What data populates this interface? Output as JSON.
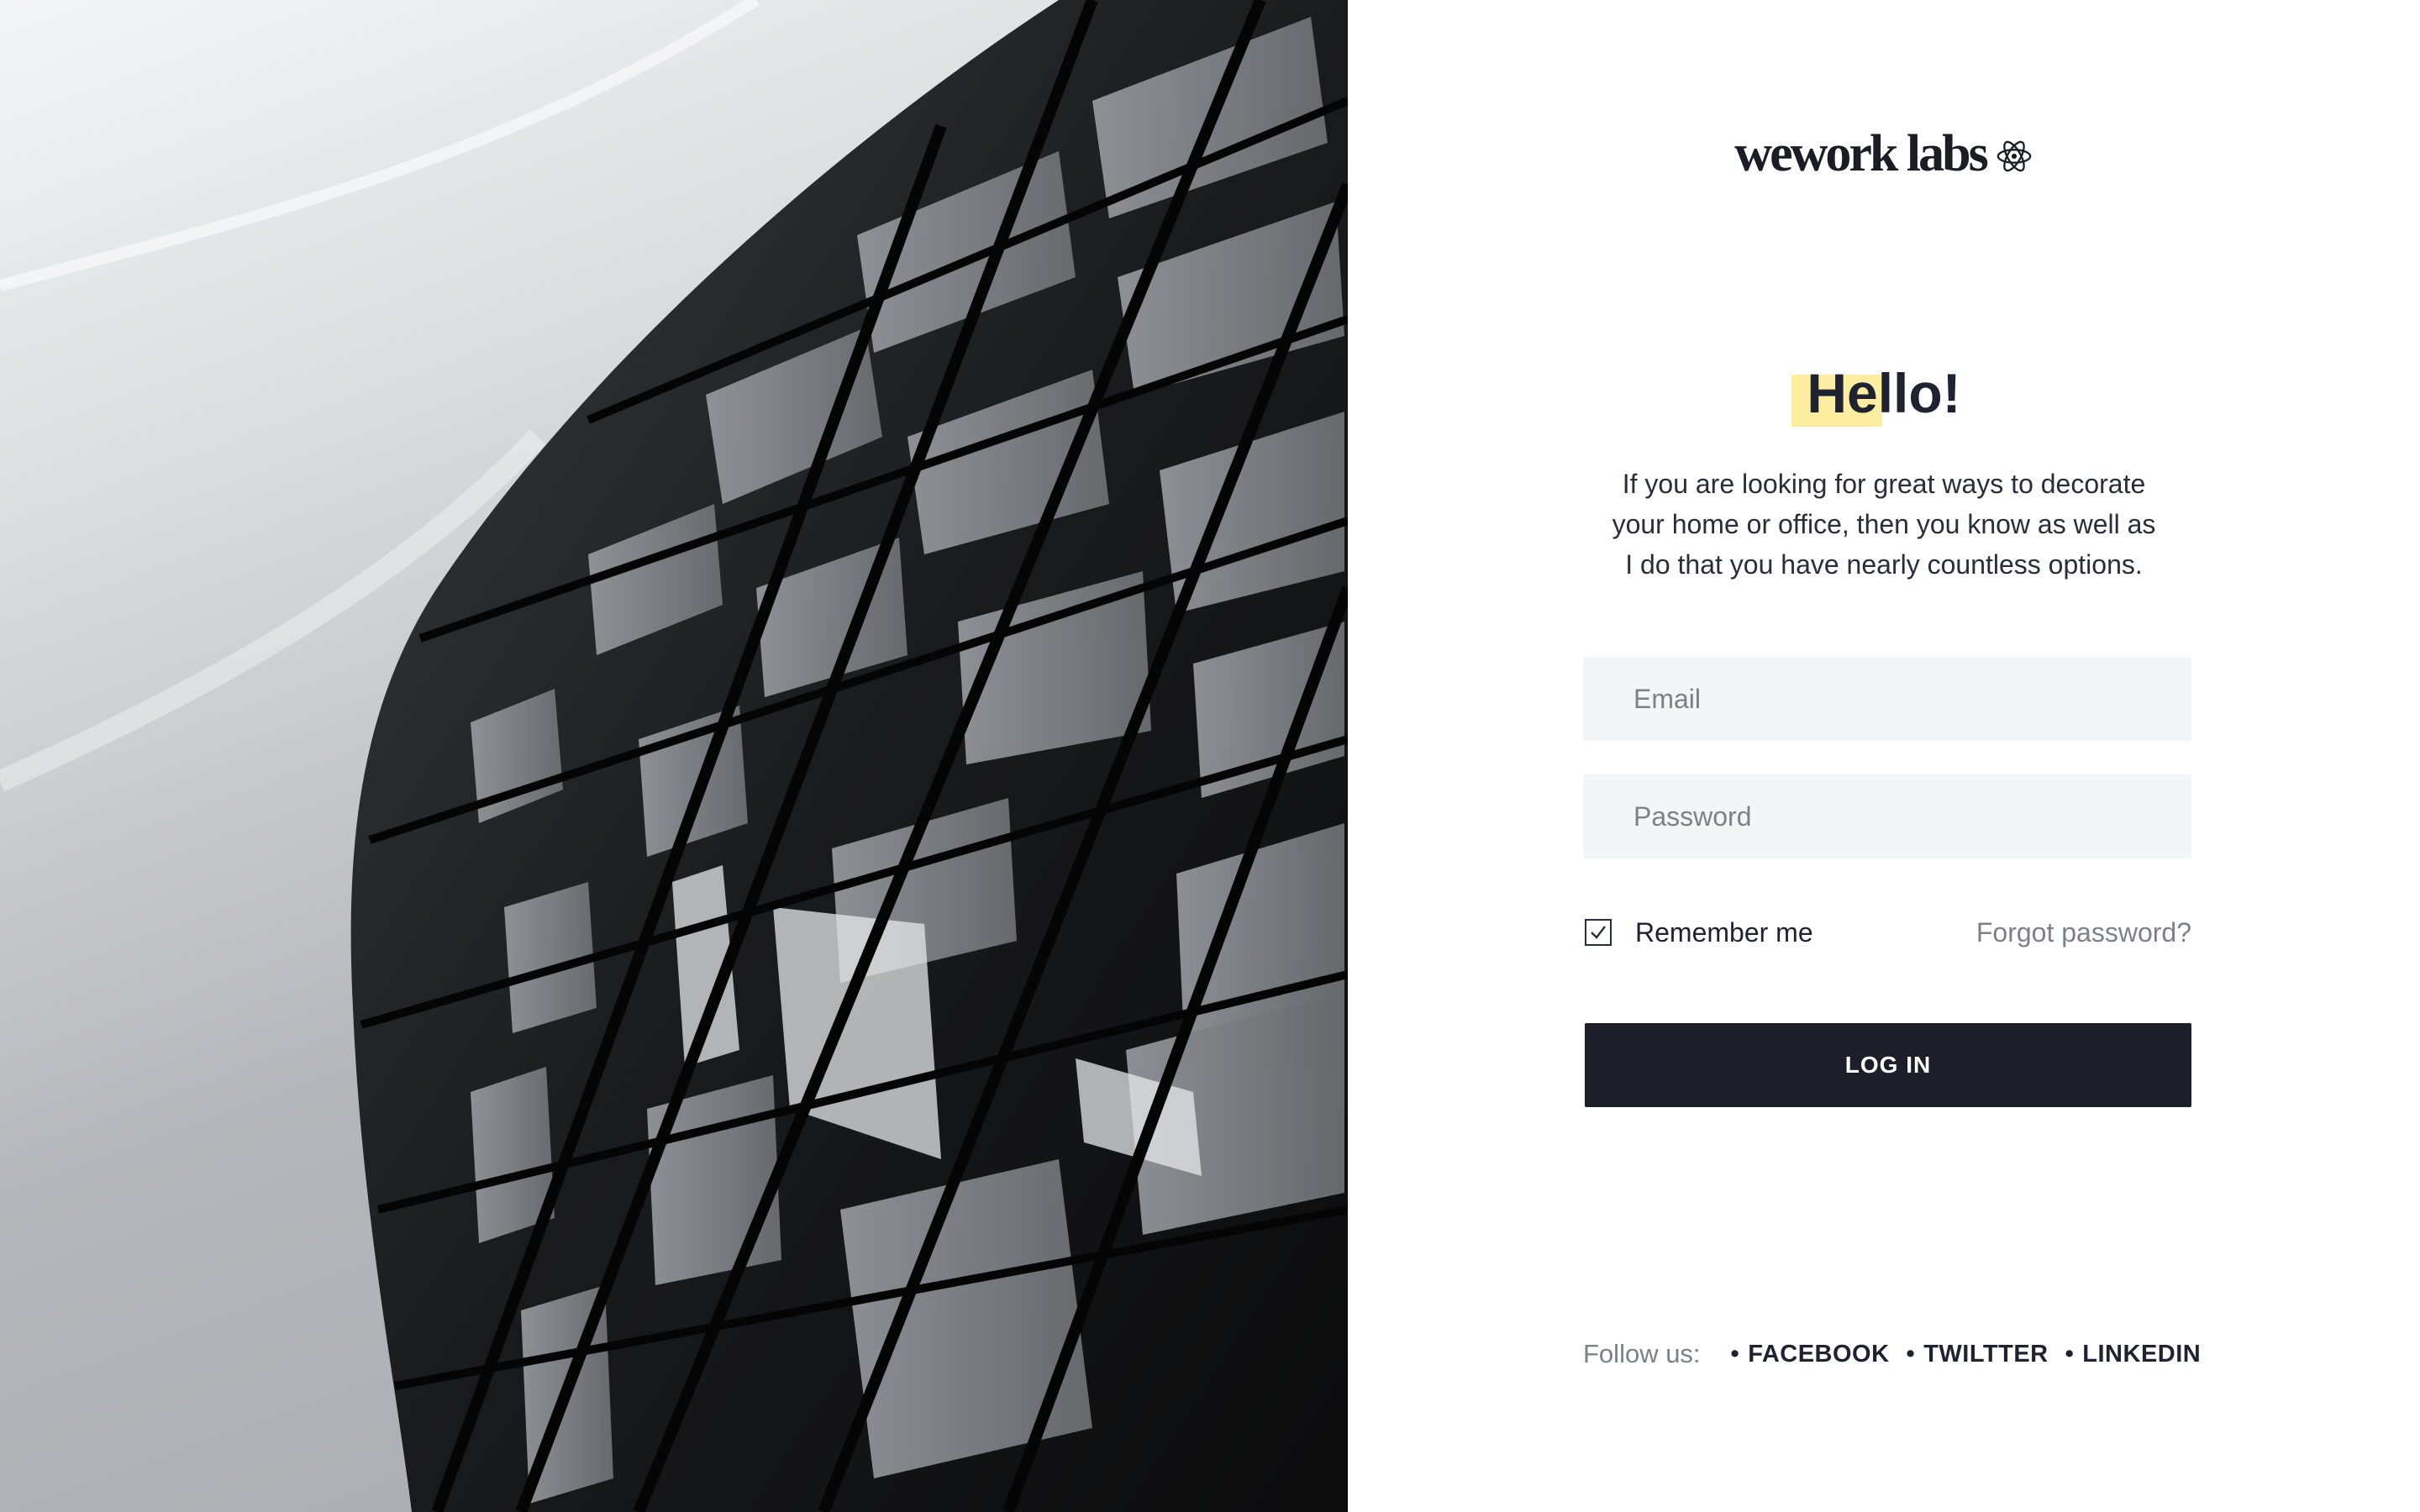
{
  "brand": {
    "logo_text": "wework labs",
    "logo_icon": "atom-icon"
  },
  "hero": {
    "image_description_icon": "building-photo"
  },
  "login": {
    "greeting": "Hello!",
    "intro_lines": [
      "If you are looking for great ways to decorate",
      "your home or office, then you know as well as",
      "I do that you have nearly countless options."
    ],
    "email_placeholder": "Email",
    "email_value": "",
    "password_placeholder": "Password",
    "password_value": "",
    "remember_label": "Remember me",
    "remember_checked": true,
    "forgot_label": "Forgot password?",
    "submit_label": "LOG IN"
  },
  "footer": {
    "follow_label": "Follow us:",
    "bullet": "•",
    "links": [
      {
        "label": "FACEBOOK"
      },
      {
        "label": "TWILTTER"
      },
      {
        "label": "LINKEDIN"
      }
    ]
  },
  "colors": {
    "accent_highlight": "#fdeda1",
    "button_bg": "#1c1e2a",
    "field_bg": "#f4f5f7",
    "muted_text": "#7d8089"
  }
}
